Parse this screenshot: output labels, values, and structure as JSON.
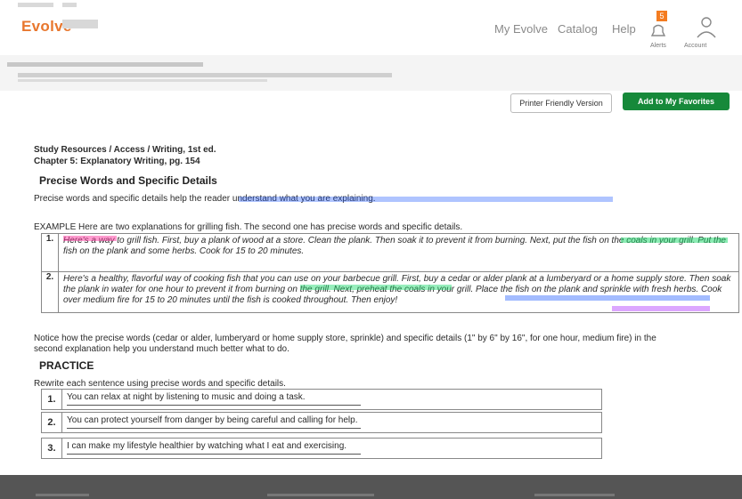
{
  "header": {
    "logo": "Evolve",
    "nav": [
      "My Evolve",
      "Catalog",
      "Help"
    ],
    "alert_count": "5",
    "alerts_label": "Alerts",
    "account_label": "Account"
  },
  "toolbar": {
    "print_label": "Printer Friendly Version",
    "add_label": "Add to My Favorites"
  },
  "doc": {
    "source_line": "Study Resources / Access / Writing, 1st ed.",
    "chapter_line": "Chapter 5: Explanatory Writing, pg. 154",
    "section_title": "Precise Words and Specific Details",
    "intro": "Precise words and specific details help the reader understand what you are explaining.",
    "example_lead": "EXAMPLE Here are two explanations for grilling fish. The second one has precise words and specific details.",
    "examples": [
      {
        "num": "1.",
        "text": "Here's a way to grill fish. First, buy a plank of wood at a store. Clean the plank. Then soak it to prevent it from burning. Next, put the fish on the coals in your grill. Put the fish on the plank and some herbs. Cook for 15 to 20 minutes."
      },
      {
        "num": "2.",
        "text": "Here's a healthy, flavorful way of cooking fish that you can use on your barbecue grill. First, buy a cedar or alder plank at a lumberyard or a home supply store. Then soak the plank in water for one hour to prevent it from burning on the grill. Next, preheat the coals in your grill. Place the fish on the plank and sprinkle with fresh herbs. Cook over medium fire for 15 to 20 minutes until the fish is cooked throughout. Then enjoy!"
      }
    ],
    "notice": "Notice how the precise words (cedar or alder, lumberyard or home supply store, sprinkle) and specific details (1\" by 6\" by 16\", for one hour, medium fire) in the second explanation help you understand much better what to do.",
    "practice_title": "PRACTICE",
    "practice_lead": "Rewrite each sentence using precise words and specific details.",
    "practice": [
      {
        "num": "1.",
        "text": "You can relax at night by listening to music and doing a task."
      },
      {
        "num": "2.",
        "text": "You can protect yourself from danger by being careful and calling for help."
      },
      {
        "num": "3.",
        "text": "I can make my lifestyle healthier by watching what I eat and exercising."
      }
    ]
  },
  "colors": {
    "brand": "#e8772e",
    "add_button": "#16893a",
    "highlight_pink": "#ff3aa0",
    "highlight_green": "#19d96a",
    "highlight_blue": "#1a57ff",
    "highlight_purple": "#b23bff"
  }
}
